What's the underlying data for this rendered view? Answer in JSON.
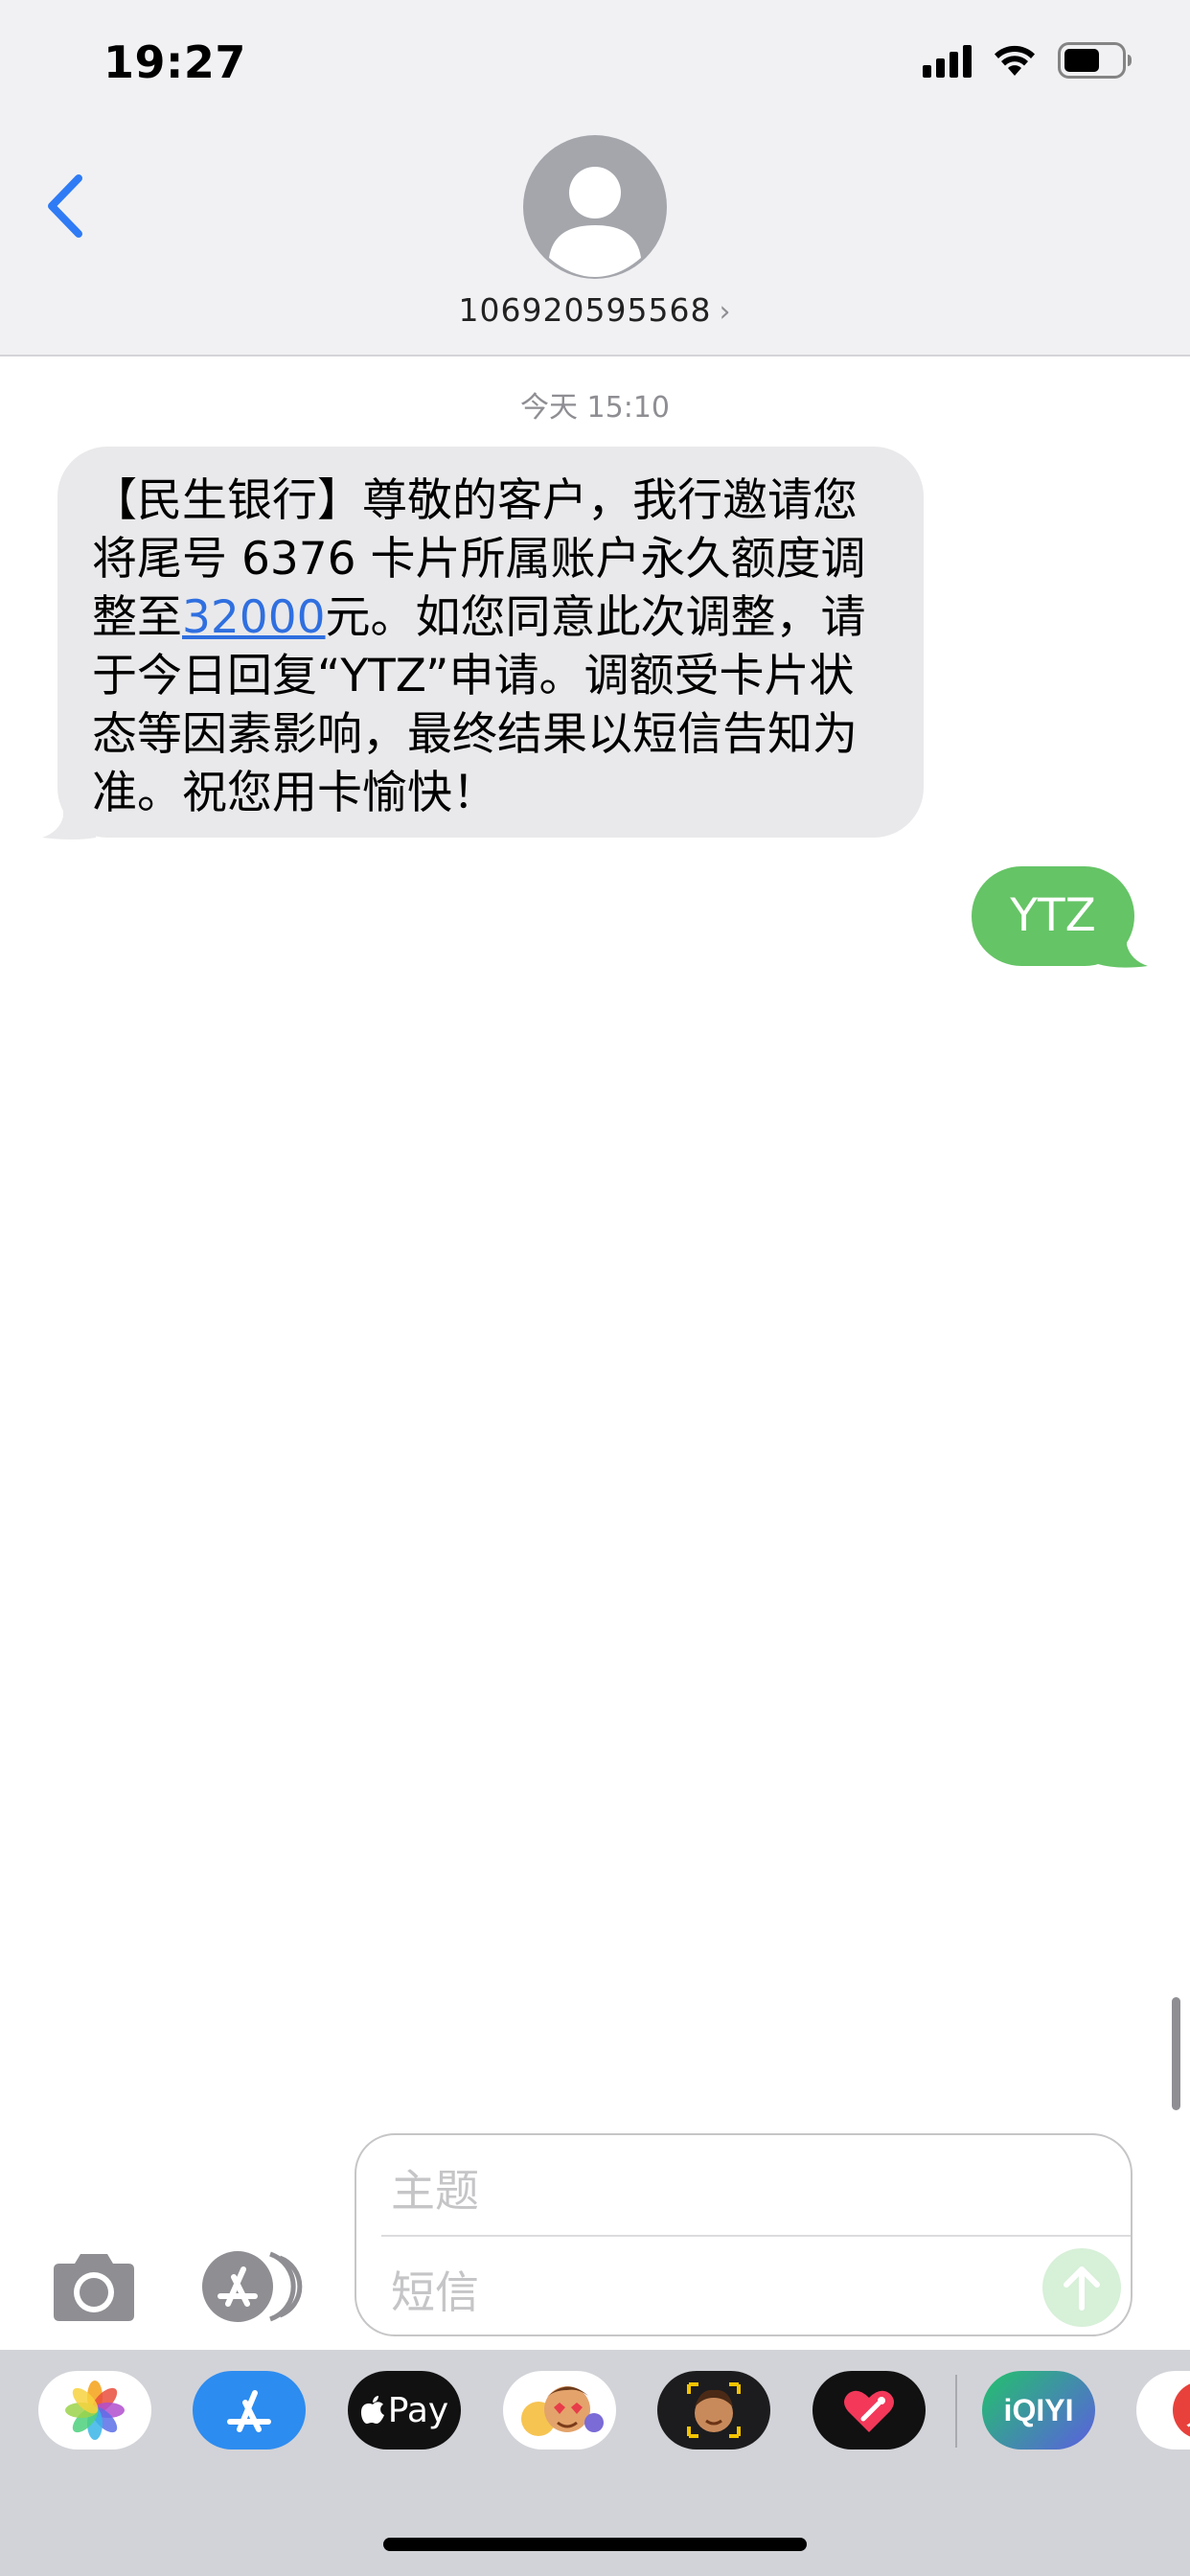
{
  "status_bar": {
    "time": "19:27"
  },
  "header": {
    "contact_number": "106920595568",
    "chevron": "›"
  },
  "thread": {
    "timestamp": "今天 15:10",
    "incoming_message": {
      "before_link": "【民生银行】尊敬的客户，我行邀请您将尾号 6376 卡片所属账户永久额度调整至",
      "link_text": "32000",
      "after_link": "元。如您同意此次调整，请于今日回复“YTZ”申请。调额受卡片状态等因素影响，最终结果以短信告知为准。祝您用卡愉快！"
    },
    "outgoing_message": "YTZ"
  },
  "compose": {
    "subject_placeholder": "主题",
    "body_placeholder": "短信"
  },
  "app_drawer": {
    "apple_pay_label": "Pay",
    "iqiyi_label": "iQIYI",
    "partial_app_label": "人"
  },
  "colors": {
    "incoming_bubble": "#e9e9eb",
    "outgoing_bubble": "#65c466",
    "link": "#2f6fe0",
    "back_chevron": "#2f7bf5",
    "header_bg": "#f1f1f3",
    "drawer_bg": "#d2d3d8"
  },
  "icons": {
    "signal": "signal-bars-icon",
    "wifi": "wifi-icon",
    "battery": "battery-icon",
    "back": "back-chevron-icon",
    "avatar": "person-silhouette-icon",
    "camera": "camera-icon",
    "apps": "app-store-icon",
    "send": "send-arrow-icon",
    "drawer_apps": [
      "photos-icon",
      "app-store-icon",
      "apple-pay-icon",
      "memoji-stickers-icon",
      "memoji-icon",
      "digital-touch-icon",
      "iqiyi-icon",
      "partial-app-icon"
    ]
  }
}
